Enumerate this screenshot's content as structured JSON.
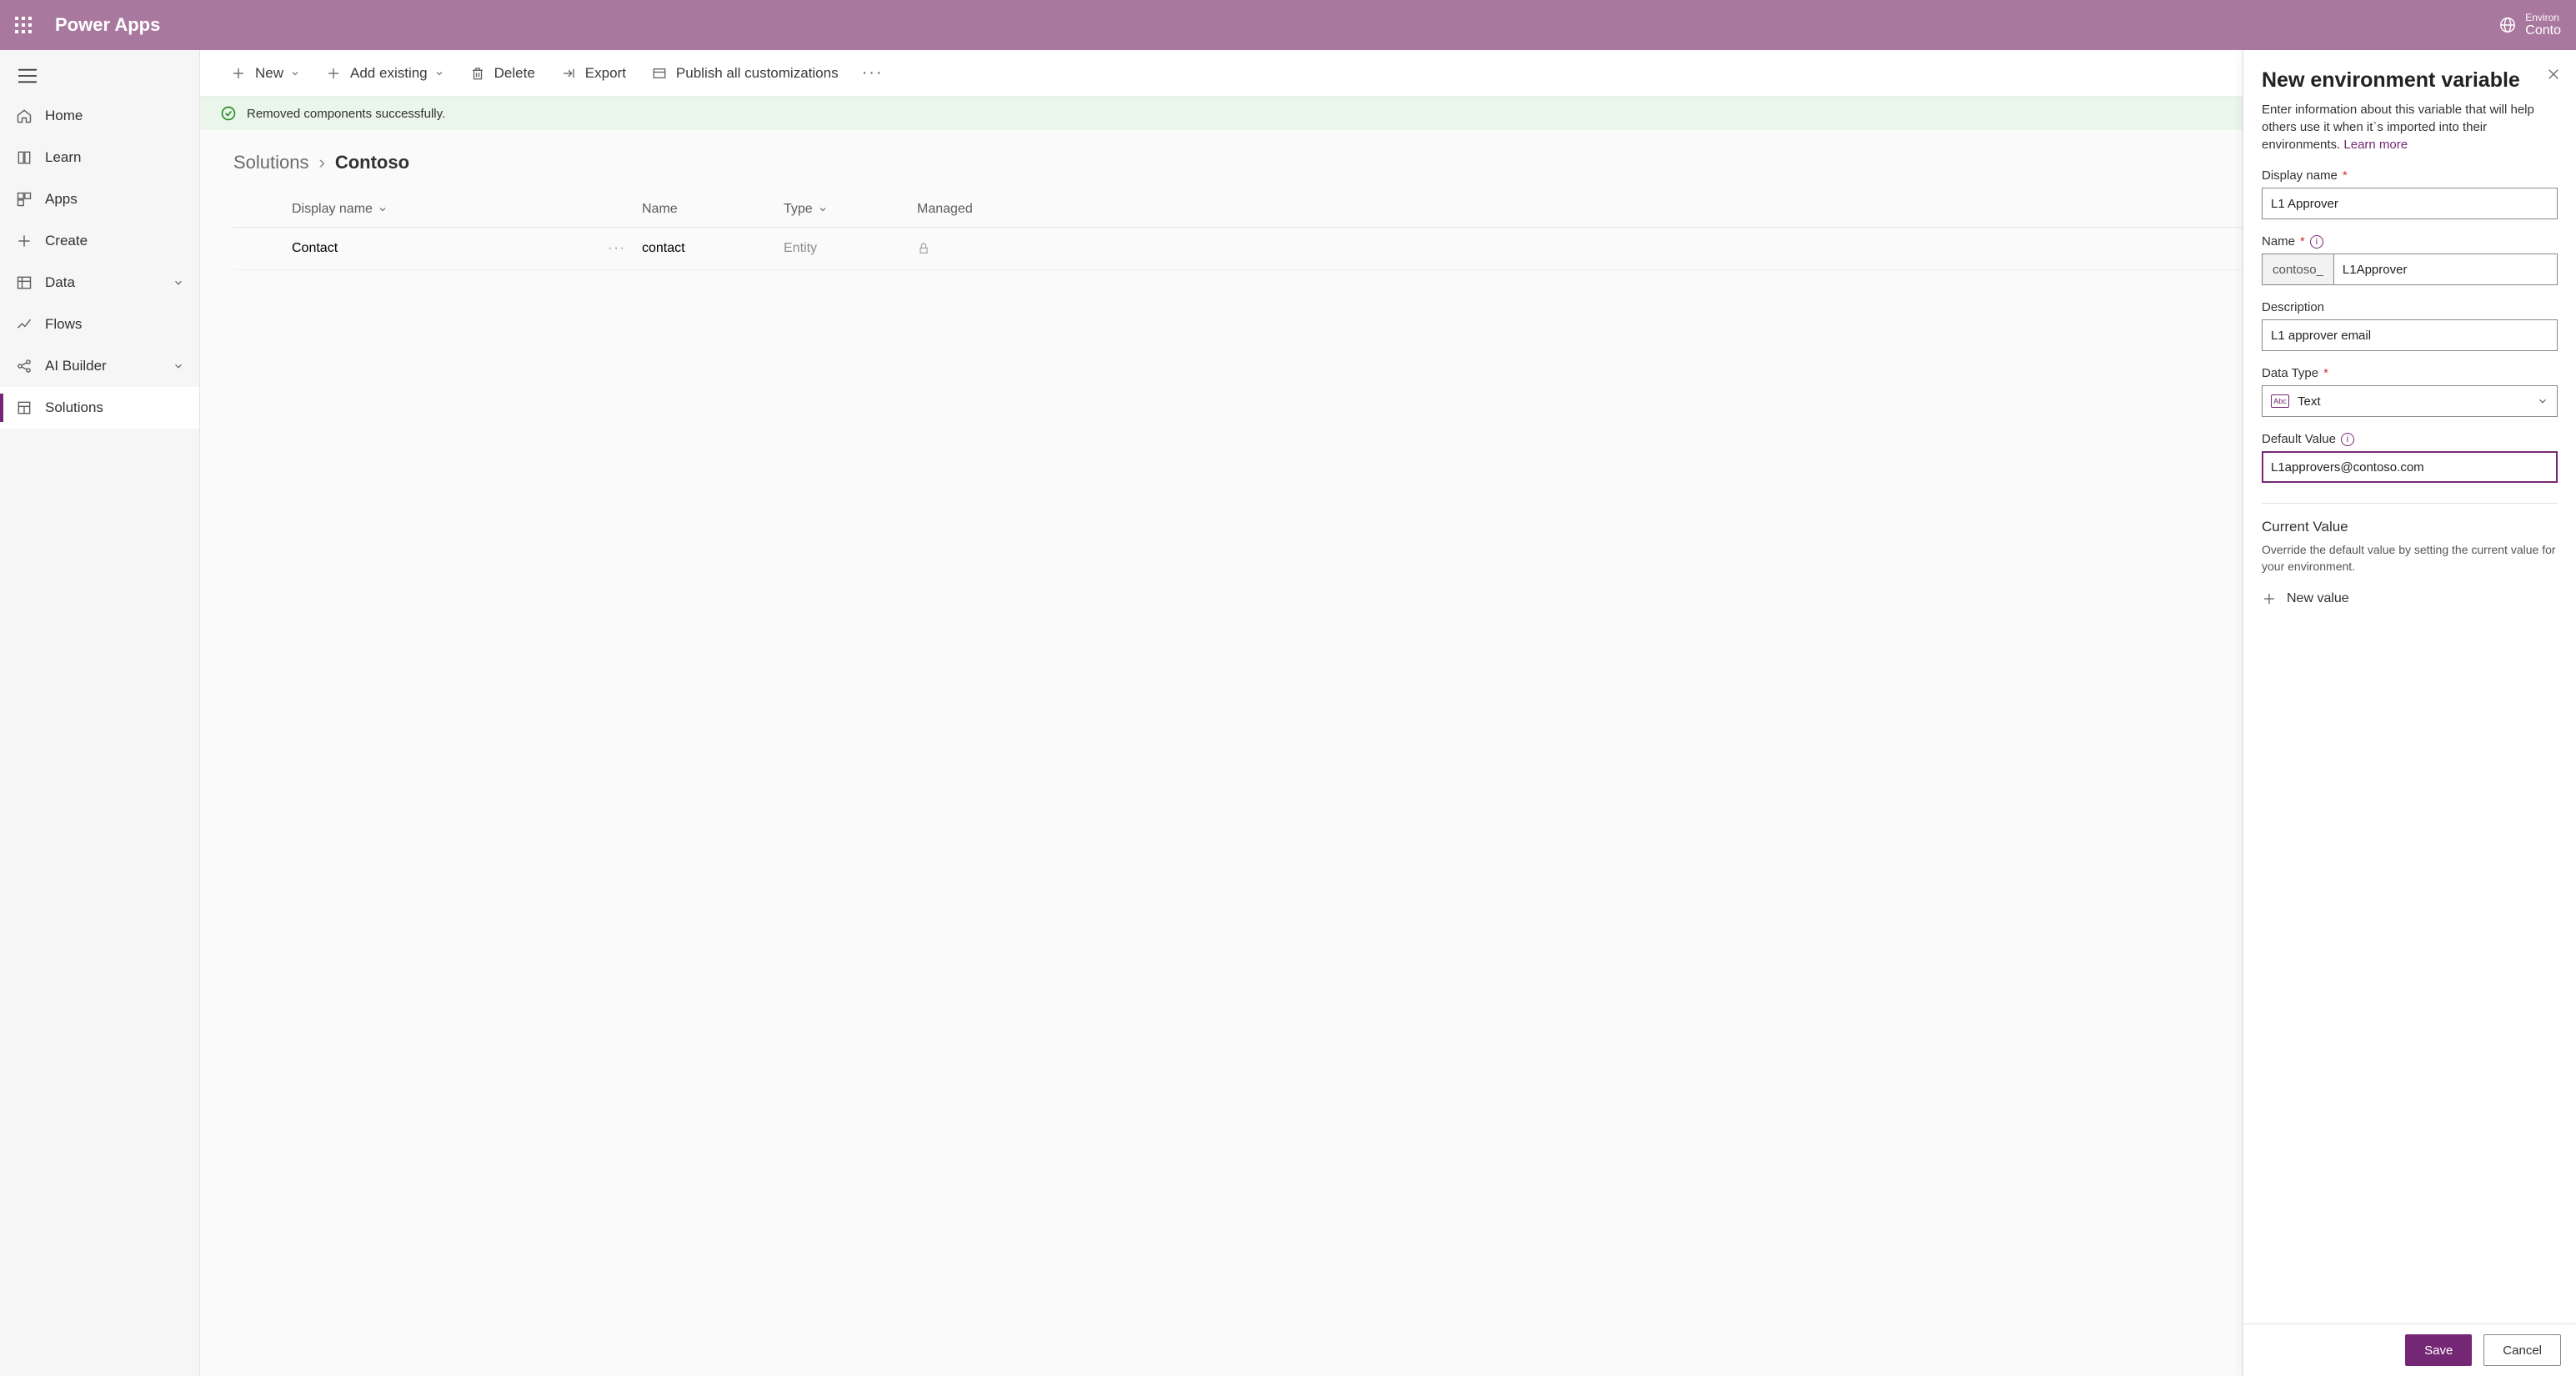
{
  "header": {
    "brand": "Power Apps",
    "env_label": "Environ",
    "env_name": "Conto"
  },
  "sidebar": {
    "items": [
      {
        "label": "Home"
      },
      {
        "label": "Learn"
      },
      {
        "label": "Apps"
      },
      {
        "label": "Create"
      },
      {
        "label": "Data"
      },
      {
        "label": "Flows"
      },
      {
        "label": "AI Builder"
      },
      {
        "label": "Solutions"
      }
    ]
  },
  "toolbar": {
    "new_label": "New",
    "addexisting_label": "Add existing",
    "delete_label": "Delete",
    "export_label": "Export",
    "publish_label": "Publish all customizations"
  },
  "banner": {
    "message": "Removed components successfully."
  },
  "breadcrumb": {
    "root": "Solutions",
    "current": "Contoso"
  },
  "columns": {
    "display_name": "Display name",
    "name": "Name",
    "type": "Type",
    "managed": "Managed"
  },
  "rows": [
    {
      "display_name": "Contact",
      "name": "contact",
      "type": "Entity"
    }
  ],
  "panel": {
    "title": "New environment variable",
    "intro": "Enter information about this variable that will help others use it when it`s imported into their environments. ",
    "learn_more": "Learn more",
    "display_name_label": "Display name",
    "display_name_value": "L1 Approver",
    "name_label": "Name",
    "name_prefix": "contoso_",
    "name_value": "L1Approver",
    "description_label": "Description",
    "description_value": "L1 approver email",
    "datatype_label": "Data Type",
    "datatype_value": "Text",
    "defaultvalue_label": "Default Value",
    "defaultvalue_value": "L1approvers@contoso.com",
    "currentvalue_title": "Current Value",
    "currentvalue_desc": "Override the default value by setting the current value for your environment.",
    "newvalue_label": "New value",
    "save_label": "Save",
    "cancel_label": "Cancel"
  }
}
